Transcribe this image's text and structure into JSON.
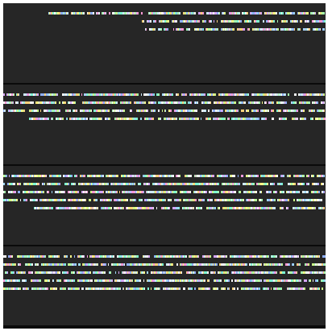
{
  "theme": {
    "background": "#262626",
    "divider": "#0a0a0a",
    "glyph_colors": [
      "#ffffff",
      "#f2f2f2",
      "#cfe9ff",
      "#9fd8ff",
      "#7fffd4",
      "#ccff88",
      "#ffff88",
      "#ffd27a",
      "#ff9ad5",
      "#d6a6ff",
      "#8fb0ff",
      "#a8ffb0"
    ]
  },
  "panels": [
    {
      "rows": [
        {
          "start": 0.14
        },
        {
          "start": 0.43
        },
        {
          "start": 0.44
        }
      ]
    },
    {
      "rows": [
        {
          "start": 0.0
        },
        {
          "start": 0.0
        },
        {
          "start": 0.0
        },
        {
          "start": 0.08
        }
      ]
    },
    {
      "rows": [
        {
          "start": 0.0
        },
        {
          "start": 0.0
        },
        {
          "start": 0.0
        },
        {
          "start": 0.0
        },
        {
          "start": 0.095
        }
      ]
    },
    {
      "rows": [
        {
          "start": 0.0
        },
        {
          "start": 0.0
        },
        {
          "start": 0.0
        },
        {
          "start": 0.0
        },
        {
          "start": 0.0
        }
      ]
    }
  ]
}
